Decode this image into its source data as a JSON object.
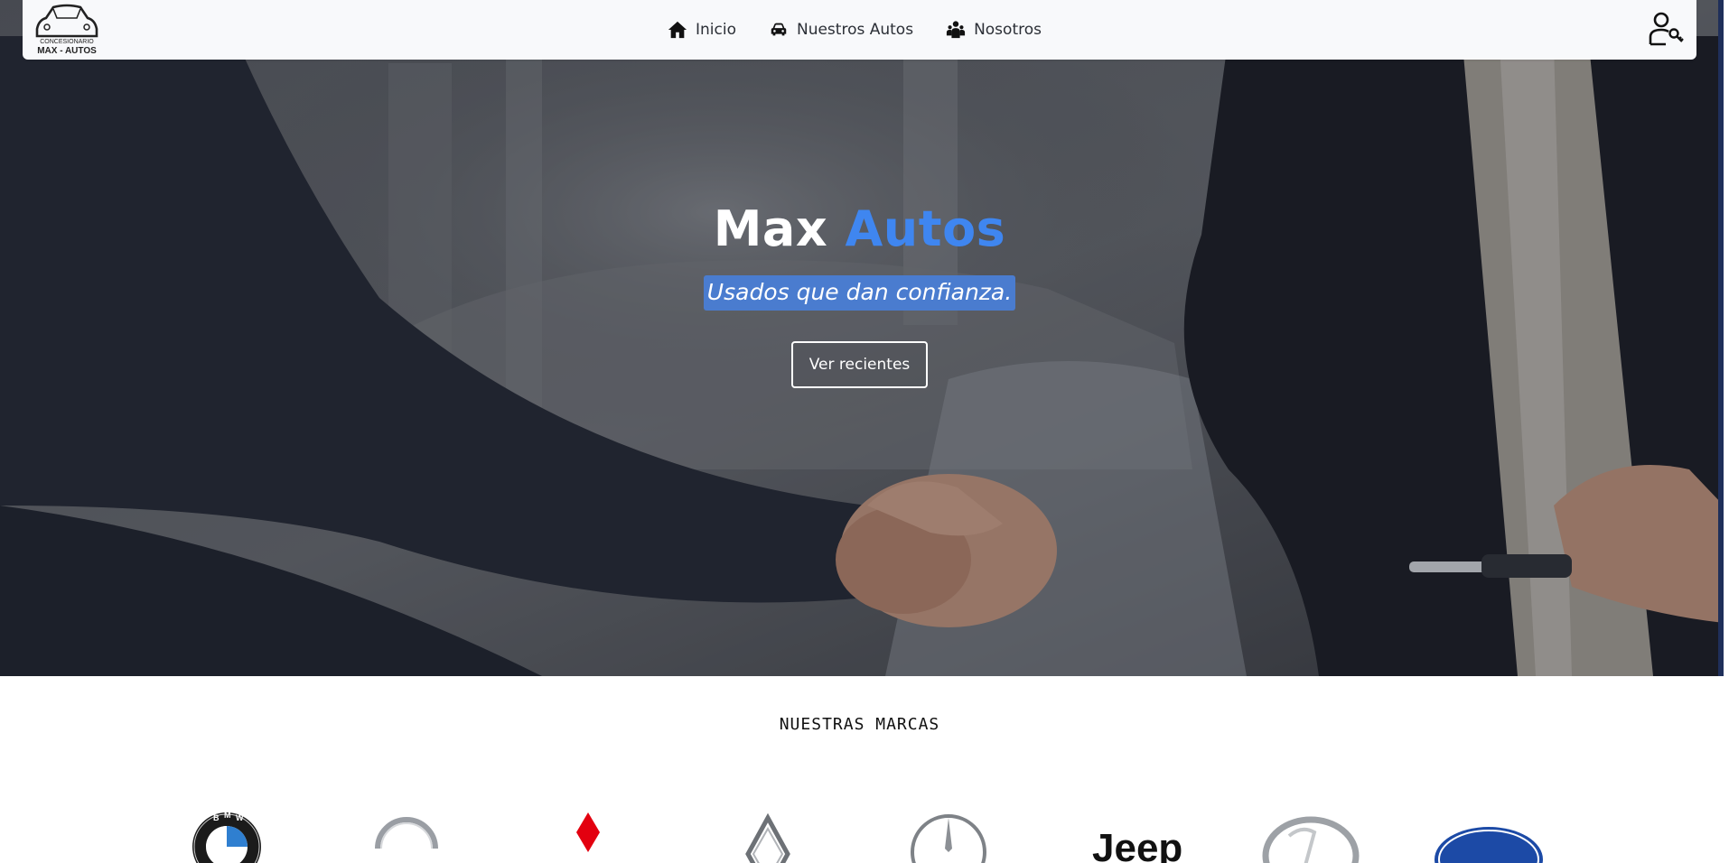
{
  "navbar": {
    "logo": {
      "line1": "CONCESIONARIO",
      "line2": "MAX - AUTOS"
    },
    "links": [
      {
        "label": "Inicio",
        "icon": "home-icon"
      },
      {
        "label": "Nuestros Autos",
        "icon": "car-icon"
      },
      {
        "label": "Nosotros",
        "icon": "team-icon"
      }
    ],
    "user_icon": "user-key-icon"
  },
  "hero": {
    "title_main": "Max",
    "title_accent": "Autos",
    "tagline": "Usados que dan confianza.",
    "button_label": "Ver recientes"
  },
  "brands": {
    "title": "NUESTRAS MARCAS",
    "items": [
      "BMW",
      "Nissan",
      "Mitsubishi",
      "Renault",
      "Mercedes-Benz",
      "Jeep",
      "Hyundai",
      "Ford"
    ]
  },
  "colors": {
    "accent": "#3f86f0",
    "tagline_bg": "#4a7ccf",
    "navbar_bg": "#f8f9fb"
  }
}
